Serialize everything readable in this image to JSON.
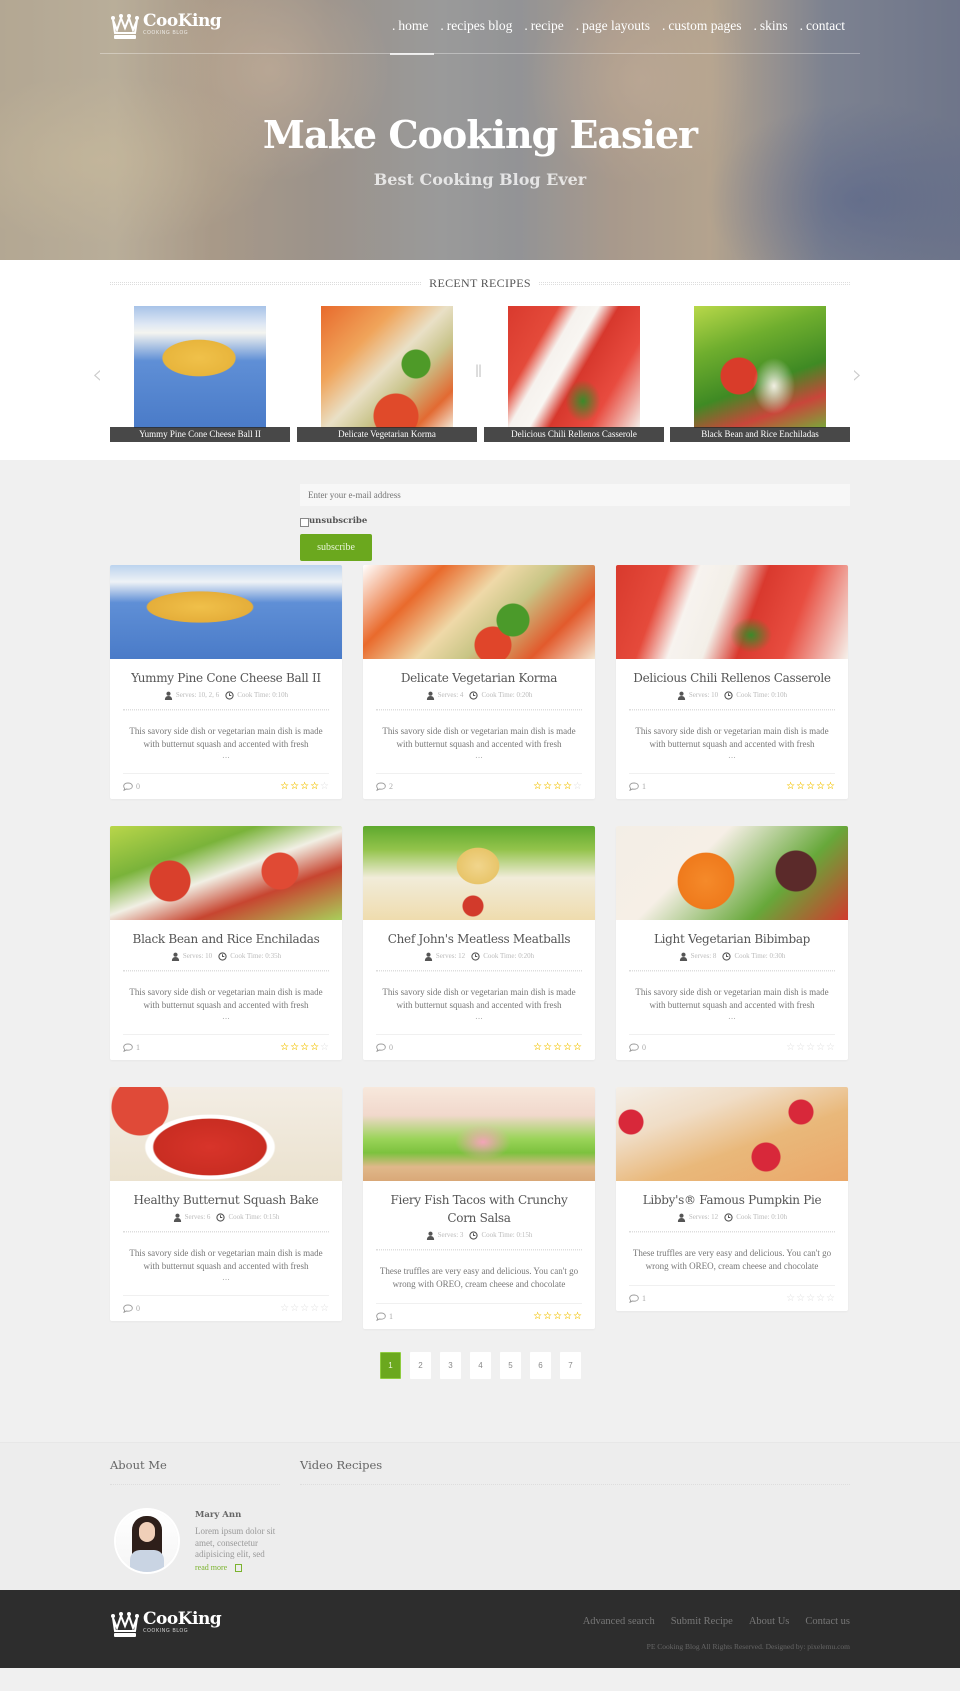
{
  "header": {
    "logo_name": "CooKing",
    "logo_sub": "COOKING BLOG",
    "menu": [
      {
        "label": "home",
        "active": true
      },
      {
        "label": "recipes blog",
        "active": false
      },
      {
        "label": "recipe",
        "active": false
      },
      {
        "label": "page layouts",
        "active": false
      },
      {
        "label": "custom pages",
        "active": false
      },
      {
        "label": "skins",
        "active": false
      },
      {
        "label": "contact",
        "active": false
      }
    ],
    "hero_title": "Make Cooking Easier",
    "hero_subtitle": "Best Cooking Blog Ever"
  },
  "recent": {
    "title": "RECENT RECIPES",
    "prev_icon": "chevron-left-icon",
    "next_icon": "chevron-right-icon",
    "pause_icon": "pause-icon",
    "slides": [
      {
        "caption": "Yummy Pine Cone Cheese Ball II"
      },
      {
        "caption": "Delicate Vegetarian Korma"
      },
      {
        "caption": "Delicious Chili Rellenos Casserole"
      },
      {
        "caption": "Black Bean and Rice Enchiladas"
      }
    ]
  },
  "subscribe": {
    "email_placeholder": "Enter your e-mail address",
    "unsubscribe_label": "unsubscribe",
    "button_label": "subscribe"
  },
  "recipes": [
    {
      "title": "Yummy Pine Cone Cheese Ball II",
      "serves": "Serves: 10, 2, 6",
      "cook_time": "Cook Time: 0:10h",
      "desc": "This savory side dish or vegetarian main dish is made with butternut squash and accented with fresh",
      "ellipsis": "...",
      "comments": "0",
      "rating": 4
    },
    {
      "title": "Delicate Vegetarian Korma",
      "serves": "Serves: 4",
      "cook_time": "Cook Time: 0:20h",
      "desc": "This savory side dish or vegetarian main dish is made with butternut squash and accented with fresh",
      "ellipsis": "...",
      "comments": "2",
      "rating": 4
    },
    {
      "title": "Delicious Chili Rellenos Casserole",
      "serves": "Serves: 10",
      "cook_time": "Cook Time: 0:10h",
      "desc": "This savory side dish or vegetarian main dish is made with butternut squash and accented with fresh",
      "ellipsis": "...",
      "comments": "1",
      "rating": 5
    },
    {
      "title": "Black Bean and Rice Enchiladas",
      "serves": "Serves: 10",
      "cook_time": "Cook Time: 0:35h",
      "desc": "This savory side dish or vegetarian main dish is made with butternut squash and accented with fresh",
      "ellipsis": "...",
      "comments": "1",
      "rating": 4
    },
    {
      "title": "Chef John's Meatless Meatballs",
      "serves": "Serves: 12",
      "cook_time": "Cook Time: 0:20h",
      "desc": "This savory side dish or vegetarian main dish is made with butternut squash and accented with fresh",
      "ellipsis": "...",
      "comments": "0",
      "rating": 5
    },
    {
      "title": "Light Vegetarian Bibimbap",
      "serves": "Serves: 8",
      "cook_time": "Cook Time: 0:30h",
      "desc": "This savory side dish or vegetarian main dish is made with butternut squash and accented with fresh",
      "ellipsis": "...",
      "comments": "0",
      "rating": 0
    },
    {
      "title": "Healthy Butternut Squash Bake",
      "serves": "Serves: 6",
      "cook_time": "Cook Time: 0:15h",
      "desc": "This savory side dish or vegetarian main dish is made with butternut squash and accented with fresh",
      "ellipsis": "...",
      "comments": "0",
      "rating": 0
    },
    {
      "title": "Fiery Fish Tacos with Crunchy Corn Salsa",
      "serves": "Serves: 3",
      "cook_time": "Cook Time: 0:15h",
      "desc": "These truffles are very easy and delicious. You can't go wrong with OREO, cream cheese and chocolate",
      "ellipsis": "",
      "comments": "1",
      "rating": 5
    },
    {
      "title": "Libby's® Famous Pumpkin Pie",
      "serves": "Serves: 12",
      "cook_time": "Cook Time: 0:10h",
      "desc": "These truffles are very easy and delicious. You can't go wrong with OREO, cream cheese and chocolate",
      "ellipsis": "",
      "comments": "1",
      "rating": 0
    }
  ],
  "pagination": {
    "pages": [
      "1",
      "2",
      "3",
      "4",
      "5",
      "6",
      "7"
    ],
    "current": "1"
  },
  "widgets": {
    "about_title": "About Me",
    "video_title": "Video Recipes",
    "author_name": "Mary Ann",
    "author_bio": "Lorem ipsum dolor sit amet, consectetur adipisicing elit, sed",
    "read_more": "read more"
  },
  "footer": {
    "logo_name": "CooKing",
    "logo_sub": "COOKING BLOG",
    "links": [
      "Advanced search",
      "Submit Recipe",
      "About Us",
      "Contact us"
    ],
    "copyright": "PE Cooking Blog All Rights Reserved. Designed by: pixelemu.com"
  },
  "colors": {
    "accent": "#6ba81e",
    "star": "#f2c200",
    "footer_bg": "#2d2d2d"
  }
}
